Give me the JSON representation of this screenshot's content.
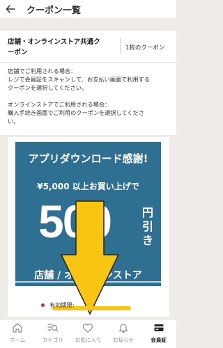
{
  "header": {
    "title": "クーポン一覧"
  },
  "coupon_card": {
    "title_line1": "店舗・オンラインストア共通ク",
    "title_line2": "ーポン",
    "count": "1枚のクーポン"
  },
  "info": {
    "store_line1": "店舗でご利用される場合：",
    "store_line2": "レジで会員証をスキャンして、お支払い画面で利用する",
    "store_line3": "クーポンを選択してください。",
    "online_line1": "オンラインストアでご利用される場合：",
    "online_line2": "購入手続き画面でご利用のクーポンを選択してくださ",
    "online_line3": "い。"
  },
  "banner": {
    "line1": "アプリダウンロード感謝!",
    "line2": "¥5,000 以上お買い上げで",
    "amount": "500",
    "unit_top": "円",
    "unit_bottom": "引き",
    "store": "店舗 / オンラインストア"
  },
  "expiry": {
    "label": "有効期限:"
  },
  "nav": [
    {
      "label": "ホーム",
      "icon": "home-icon"
    },
    {
      "label": "カテゴリ",
      "icon": "category-search-icon"
    },
    {
      "label": "お気に入り",
      "icon": "heart-icon"
    },
    {
      "label": "お知らせ",
      "icon": "bell-icon"
    },
    {
      "label": "会員証",
      "icon": "member-card-icon"
    }
  ],
  "colors": {
    "banner_bg": "#2e6f92",
    "arrow": "#f7c512",
    "expiry_dot": "#d3282e",
    "background": "#efebe6"
  }
}
